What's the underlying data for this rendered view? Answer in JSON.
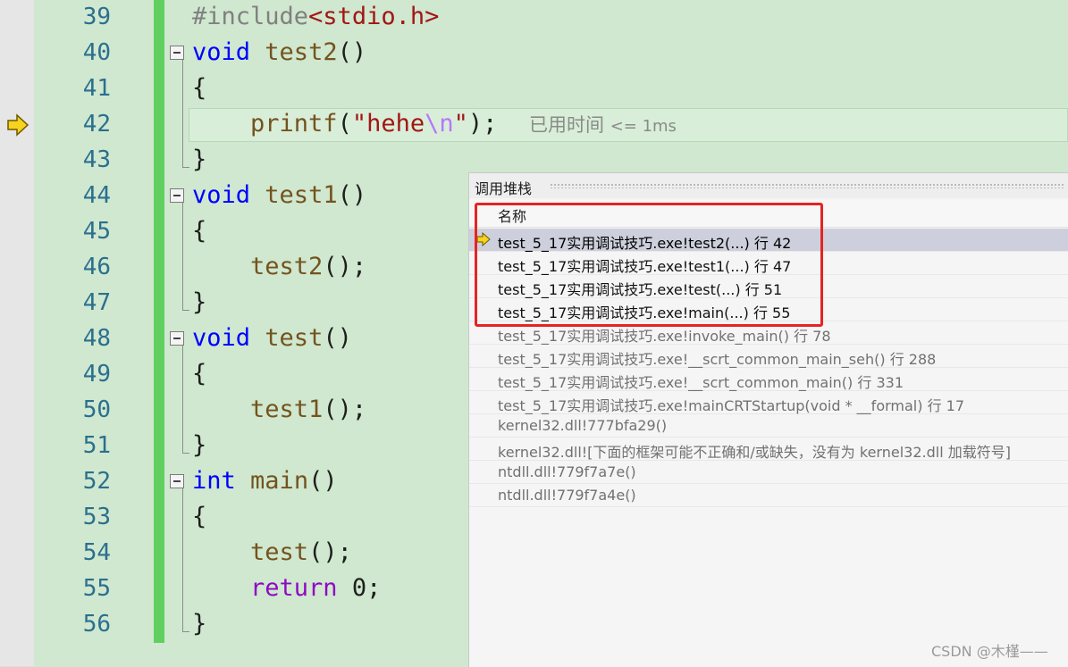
{
  "editor": {
    "lines": [
      {
        "num": "39",
        "tokens": [
          {
            "t": "#include",
            "c": "pp"
          },
          {
            "t": "<stdio.h>",
            "c": "hdr"
          }
        ]
      },
      {
        "num": "40",
        "tokens": [
          {
            "t": "void",
            "c": "kw"
          },
          {
            "t": " "
          },
          {
            "t": "test2",
            "c": "fn"
          },
          {
            "t": "()"
          }
        ]
      },
      {
        "num": "41",
        "tokens": [
          {
            "t": "{"
          }
        ]
      },
      {
        "num": "42",
        "tokens": [
          {
            "t": "    "
          },
          {
            "t": "printf",
            "c": "fn"
          },
          {
            "t": "("
          },
          {
            "t": "\"hehe",
            "c": "str"
          },
          {
            "t": "\\n",
            "c": "esc"
          },
          {
            "t": "\"",
            "c": "str"
          },
          {
            "t": ");"
          }
        ]
      },
      {
        "num": "43",
        "tokens": [
          {
            "t": "}"
          }
        ]
      },
      {
        "num": "44",
        "tokens": [
          {
            "t": "void",
            "c": "kw"
          },
          {
            "t": " "
          },
          {
            "t": "test1",
            "c": "fn"
          },
          {
            "t": "()"
          }
        ]
      },
      {
        "num": "45",
        "tokens": [
          {
            "t": "{"
          }
        ]
      },
      {
        "num": "46",
        "tokens": [
          {
            "t": "    "
          },
          {
            "t": "test2",
            "c": "fn"
          },
          {
            "t": "();"
          }
        ]
      },
      {
        "num": "47",
        "tokens": [
          {
            "t": "}"
          }
        ]
      },
      {
        "num": "48",
        "tokens": [
          {
            "t": "void",
            "c": "kw"
          },
          {
            "t": " "
          },
          {
            "t": "test",
            "c": "fn"
          },
          {
            "t": "()"
          }
        ]
      },
      {
        "num": "49",
        "tokens": [
          {
            "t": "{"
          }
        ]
      },
      {
        "num": "50",
        "tokens": [
          {
            "t": "    "
          },
          {
            "t": "test1",
            "c": "fn"
          },
          {
            "t": "();"
          }
        ]
      },
      {
        "num": "51",
        "tokens": [
          {
            "t": "}"
          }
        ]
      },
      {
        "num": "52",
        "tokens": [
          {
            "t": "int",
            "c": "kw"
          },
          {
            "t": " "
          },
          {
            "t": "main",
            "c": "fn"
          },
          {
            "t": "()"
          }
        ]
      },
      {
        "num": "53",
        "tokens": [
          {
            "t": "{"
          }
        ]
      },
      {
        "num": "54",
        "tokens": [
          {
            "t": "    "
          },
          {
            "t": "test",
            "c": "fn"
          },
          {
            "t": "();"
          }
        ]
      },
      {
        "num": "55",
        "tokens": [
          {
            "t": "    "
          },
          {
            "t": "return",
            "c": "kw2"
          },
          {
            "t": " "
          },
          {
            "t": "0",
            "c": "num"
          },
          {
            "t": ";"
          }
        ]
      },
      {
        "num": "56",
        "tokens": [
          {
            "t": "}"
          }
        ]
      }
    ],
    "perf_tip": {
      "label": "已用时间",
      "value": "<= 1ms"
    },
    "current_line_icon": "yellow-arrow-icon"
  },
  "callstack": {
    "title": "调用堆栈",
    "column_name": "名称",
    "rows": [
      {
        "text": "test_5_17实用调试技巧.exe!test2(...) 行 42",
        "state": "active"
      },
      {
        "text": "test_5_17实用调试技巧.exe!test1(...) 行 47",
        "state": "strong"
      },
      {
        "text": "test_5_17实用调试技巧.exe!test(...) 行 51",
        "state": "strong"
      },
      {
        "text": "test_5_17实用调试技巧.exe!main(...) 行 55",
        "state": "strong"
      },
      {
        "text": "test_5_17实用调试技巧.exe!invoke_main() 行 78",
        "state": "dim"
      },
      {
        "text": "test_5_17实用调试技巧.exe!__scrt_common_main_seh() 行 288",
        "state": "dim"
      },
      {
        "text": "test_5_17实用调试技巧.exe!__scrt_common_main() 行 331",
        "state": "dim"
      },
      {
        "text": "test_5_17实用调试技巧.exe!mainCRTStartup(void * __formal) 行 17",
        "state": "dim"
      },
      {
        "text": "kernel32.dll!777bfa29()",
        "state": "dim"
      },
      {
        "text": "kernel32.dll![下面的框架可能不正确和/或缺失，没有为 kernel32.dll 加载符号]",
        "state": "dim"
      },
      {
        "text": "ntdll.dll!779f7a7e()",
        "state": "dim"
      },
      {
        "text": "ntdll.dll!779f7a4e()",
        "state": "dim"
      }
    ],
    "highlight_color": "#e62323"
  },
  "watermark": "CSDN @木槿——"
}
